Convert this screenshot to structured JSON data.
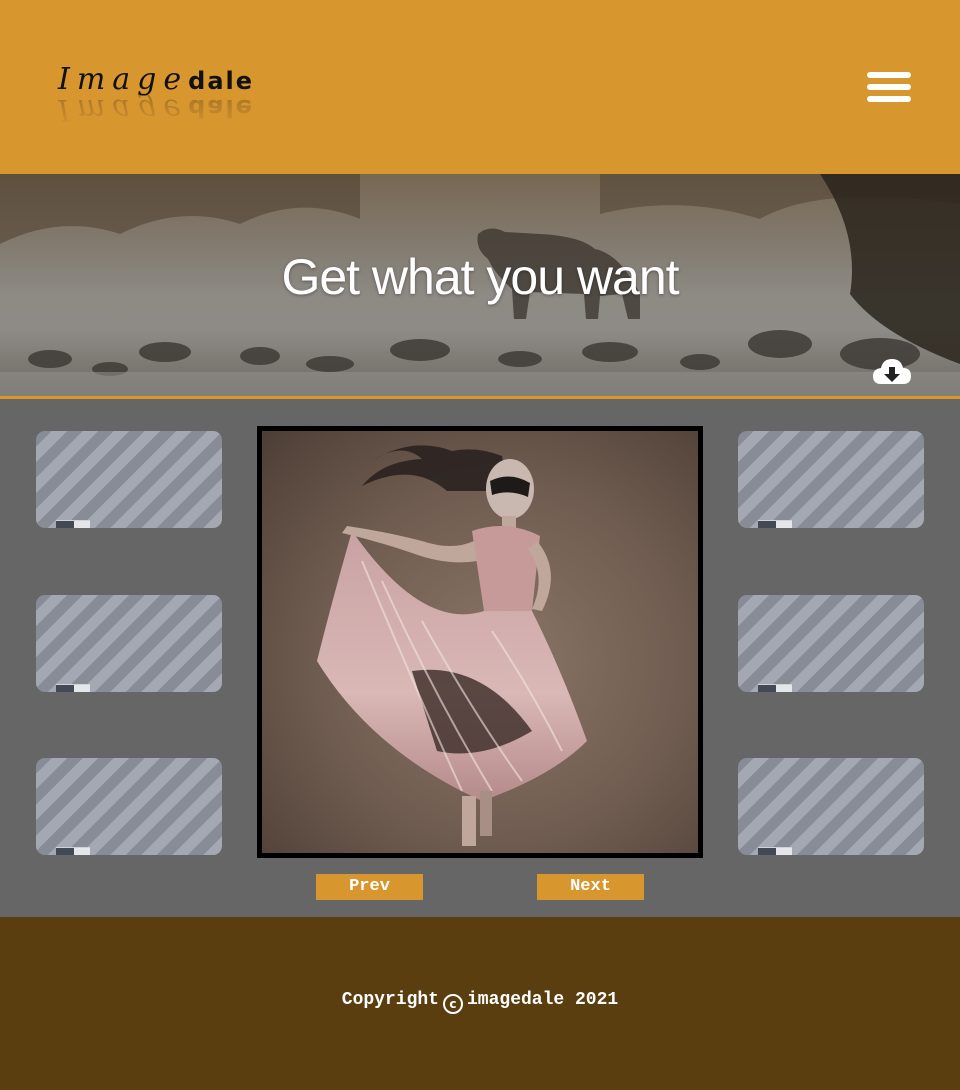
{
  "header": {
    "logo_script": "Image",
    "logo_suffix": "dale",
    "menu_icon": "hamburger-menu-icon"
  },
  "banner": {
    "title": "Get what you want",
    "download_icon": "cloud-download-icon"
  },
  "gallery": {
    "left_thumbnails": 3,
    "right_thumbnails": 3,
    "featured_alt": "painting of a woman in a pink dress"
  },
  "pagination": {
    "prev_label": "Prev",
    "next_label": "Next"
  },
  "footer": {
    "copyright_prefix": "Copyright",
    "copyright_symbol": "c",
    "copyright_suffix": "imagedale 2021"
  },
  "colors": {
    "header_bg": "#d8962f",
    "gallery_bg": "#666666",
    "footer_bg": "#5a3e0f",
    "accent": "#d8962f"
  }
}
